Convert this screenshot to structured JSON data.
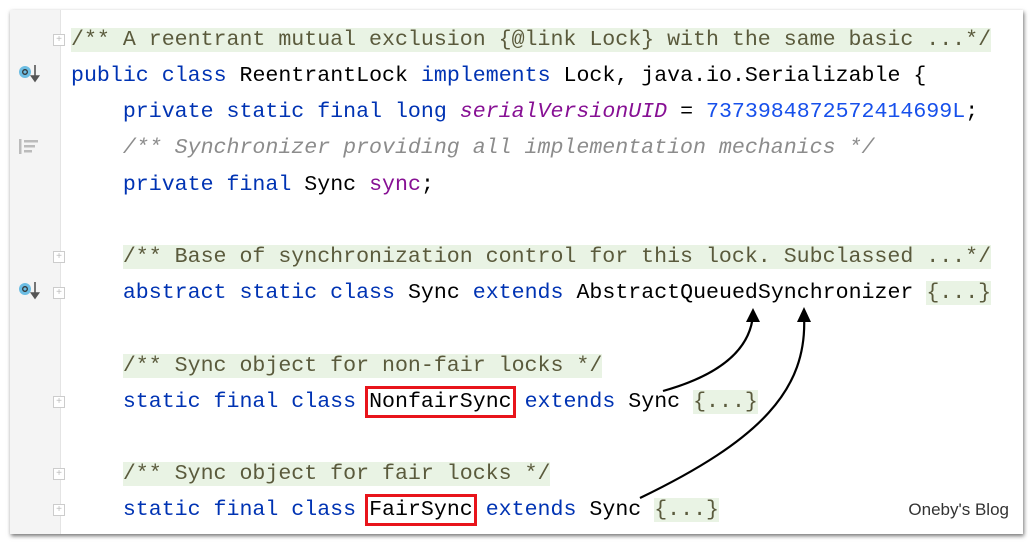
{
  "code": {
    "line1": "/** A reentrant mutual exclusion {@link Lock} with the same basic ...*/",
    "line2": {
      "kw1": "public",
      "kw2": "class",
      "name": "ReentrantLock",
      "kw3": "implements",
      "rest": "Lock, java.io.Serializable {"
    },
    "line3": {
      "kw": "private static final long",
      "field": "serialVersionUID",
      "eq": " = ",
      "num": "7373984872572414699L",
      "end": ";"
    },
    "line4": "/** Synchronizer providing all implementation mechanics */",
    "line5": {
      "kw": "private final",
      "type": "Sync",
      "field": "sync",
      "end": ";"
    },
    "line6": "/** Base of synchronization control for this lock. Subclassed ...*/",
    "line7": {
      "kw": "abstract static class",
      "name": "Sync",
      "kw2": "extends",
      "parent": "AbstractQueuedSynchronizer",
      "fold": "{...}"
    },
    "line8": "/** Sync object for non-fair locks */",
    "line9": {
      "kw": "static final class",
      "name": "NonfairSync",
      "kw2": "extends",
      "parent": "Sync",
      "fold": "{...}"
    },
    "line10": "/** Sync object for fair locks */",
    "line11": {
      "kw": "static final class",
      "name": "FairSync",
      "kw2": "extends",
      "parent": "Sync",
      "fold": "{...}"
    }
  },
  "gutter_icons": [
    "implemented-override-icon",
    "structure-icon",
    "implemented-override-icon"
  ],
  "watermark": "Oneby's Blog",
  "colors": {
    "keyword": "#0033b3",
    "comment": "#8c8c8c",
    "field": "#871094",
    "number": "#1750eb",
    "highlight_box": "#e8141b",
    "doc_bg": "#e9f3e4"
  }
}
